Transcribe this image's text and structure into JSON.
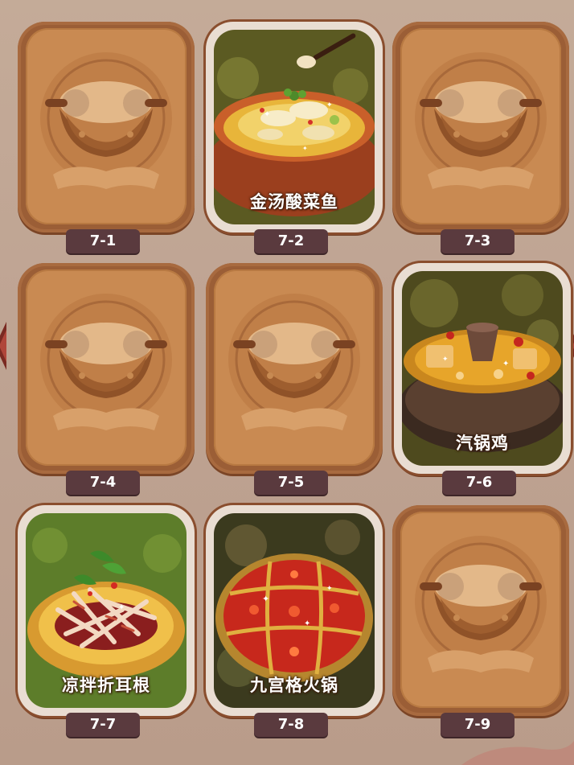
{
  "levels": [
    {
      "id": "7-1",
      "unlocked": false,
      "dish": ""
    },
    {
      "id": "7-2",
      "unlocked": true,
      "dish": "金汤酸菜鱼"
    },
    {
      "id": "7-3",
      "unlocked": false,
      "dish": ""
    },
    {
      "id": "7-4",
      "unlocked": false,
      "dish": ""
    },
    {
      "id": "7-5",
      "unlocked": false,
      "dish": ""
    },
    {
      "id": "7-6",
      "unlocked": true,
      "dish": "汽锅鸡"
    },
    {
      "id": "7-7",
      "unlocked": true,
      "dish": "凉拌折耳根"
    },
    {
      "id": "7-8",
      "unlocked": true,
      "dish": "九宫格火锅"
    },
    {
      "id": "7-9",
      "unlocked": false,
      "dish": ""
    }
  ]
}
